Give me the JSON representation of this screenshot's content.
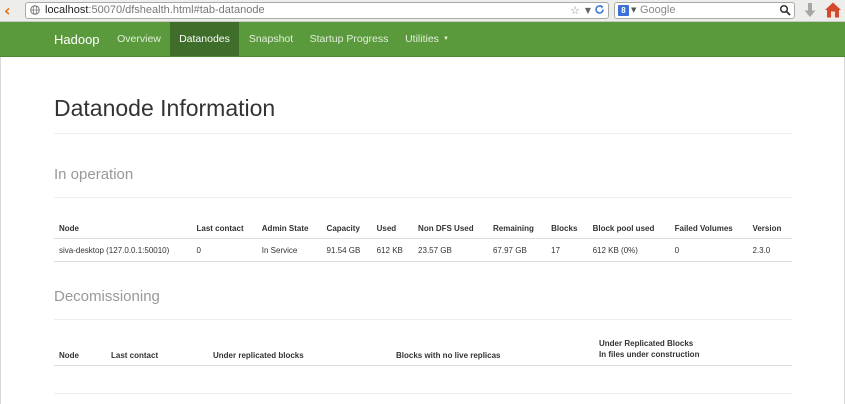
{
  "browser": {
    "url_host": "localhost",
    "url_rest": ":50070/dfshealth.html#tab-datanode",
    "search_placeholder": "Google",
    "search_engine_glyph": "8"
  },
  "navbar": {
    "brand": "Hadoop",
    "items": [
      {
        "label": "Overview",
        "active": false
      },
      {
        "label": "Datanodes",
        "active": true
      },
      {
        "label": "Snapshot",
        "active": false
      },
      {
        "label": "Startup Progress",
        "active": false
      },
      {
        "label": "Utilities",
        "active": false,
        "dropdown": true
      }
    ],
    "colors": {
      "bar": "#5a9a3c",
      "active": "#3f6e2a"
    }
  },
  "page": {
    "title": "Datanode Information"
  },
  "in_operation": {
    "heading": "In operation",
    "columns": [
      "Node",
      "Last contact",
      "Admin State",
      "Capacity",
      "Used",
      "Non DFS Used",
      "Remaining",
      "Blocks",
      "Block pool used",
      "Failed Volumes",
      "Version"
    ],
    "rows": [
      [
        "siva-desktop (127.0.0.1:50010)",
        "0",
        "In Service",
        "91.54 GB",
        "612 KB",
        "23.57 GB",
        "67.97 GB",
        "17",
        "612 KB (0%)",
        "0",
        "2.3.0"
      ]
    ]
  },
  "decommissioning": {
    "heading": "Decomissioning",
    "columns": [
      "Node",
      "Last contact",
      "Under replicated blocks",
      "Blocks with no live replicas"
    ],
    "last_column_line1": "Under Replicated Blocks",
    "last_column_line2": "In files under construction"
  }
}
